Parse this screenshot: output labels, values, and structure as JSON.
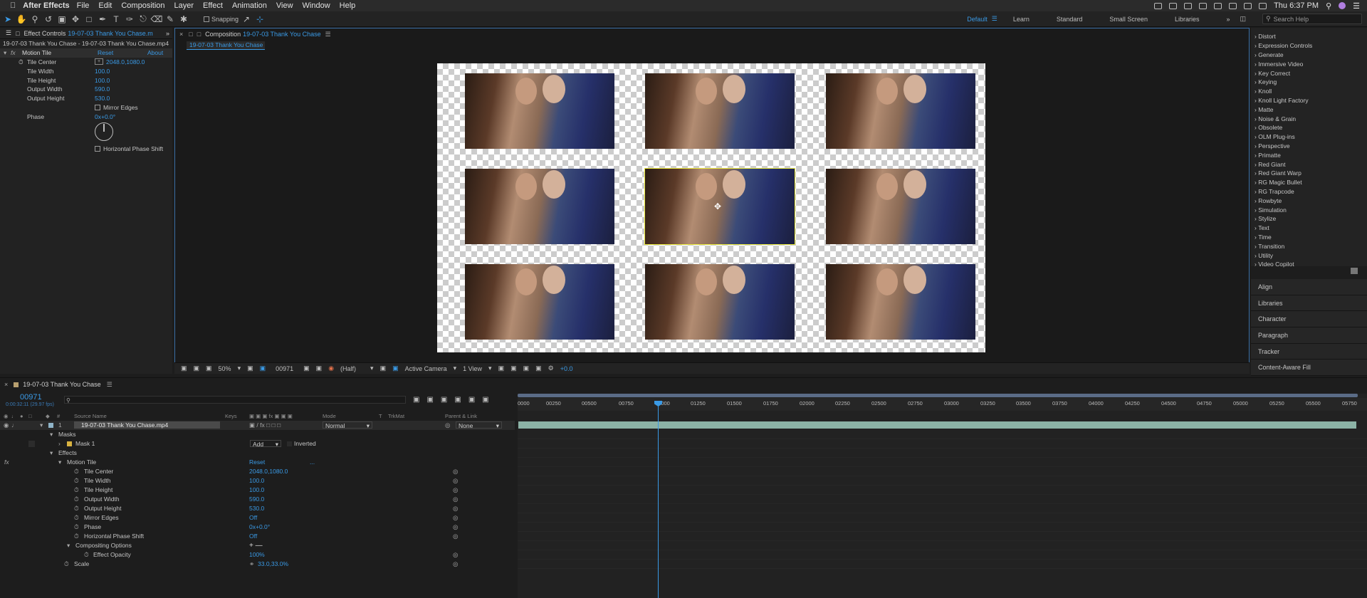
{
  "menubar": {
    "app_name": "After Effects",
    "items": [
      "File",
      "Edit",
      "Composition",
      "Layer",
      "Effect",
      "Animation",
      "View",
      "Window",
      "Help"
    ],
    "clock": "Thu 6:37 PM"
  },
  "toolbar": {
    "snapping_label": "Snapping",
    "workspaces": [
      "Default",
      "Learn",
      "Standard",
      "Small Screen",
      "Libraries"
    ],
    "active_workspace": "Default",
    "search_placeholder": "Search Help"
  },
  "effect_controls": {
    "tab_title": "Effect Controls",
    "tab_file": "19-07-03 Thank You Chase.m",
    "breadcrumb": "19-07-03 Thank You Chase - 19-07-03 Thank You Chase.mp4",
    "effect_name": "Motion Tile",
    "reset_label": "Reset",
    "about_label": "About",
    "params": [
      {
        "name": "Tile Center",
        "value": "2048.0,1080.0"
      },
      {
        "name": "Tile Width",
        "value": "100.0"
      },
      {
        "name": "Tile Height",
        "value": "100.0"
      },
      {
        "name": "Output Width",
        "value": "590.0"
      },
      {
        "name": "Output Height",
        "value": "530.0"
      }
    ],
    "mirror_edges_label": "Mirror Edges",
    "phase_label": "Phase",
    "phase_value": "0x+0.0°",
    "horizontal_phase_shift_label": "Horizontal Phase Shift"
  },
  "composition": {
    "tab_prefix": "Composition",
    "tab_name": "19-07-03 Thank You Chase",
    "sub_tab": "19-07-03 Thank You Chase",
    "footer": {
      "zoom": "50%",
      "timecode": "00971",
      "resolution": "(Half)",
      "camera": "Active Camera",
      "views": "1 View",
      "exposure": "+0.0"
    }
  },
  "effects_list": [
    "Distort",
    "Expression Controls",
    "Generate",
    "Immersive Video",
    "Key Correct",
    "Keying",
    "Knoll",
    "Knoll Light Factory",
    "Matte",
    "Noise & Grain",
    "Obsolete",
    "OLM Plug-ins",
    "Perspective",
    "Primatte",
    "Red Giant",
    "Red Giant Warp",
    "RG Magic Bullet",
    "RG Trapcode",
    "Rowbyte",
    "Simulation",
    "Stylize",
    "Text",
    "Time",
    "Transition",
    "Utility",
    "Video Copilot"
  ],
  "side_panels": [
    "Align",
    "Libraries",
    "Character",
    "Paragraph",
    "Tracker",
    "Content-Aware Fill"
  ],
  "timeline": {
    "tab_name": "19-07-03 Thank You Chase",
    "current_time": "00971",
    "time_sub": "0:00:32:11 (29.97 fps)",
    "columns": {
      "source": "Source Name",
      "keys": "Keys",
      "mode": "Mode",
      "t": "T",
      "trkmat": "TrkMat",
      "parent": "Parent & Link"
    },
    "layer": {
      "index": "1",
      "name": "19-07-03 Thank You Chase.mp4",
      "mode": "Normal",
      "parent": "None"
    },
    "masks_label": "Masks",
    "mask": {
      "name": "Mask 1",
      "mode": "Add",
      "inverted": "Inverted"
    },
    "effects_label": "Effects",
    "motion_tile_label": "Motion Tile",
    "reset_label": "Reset",
    "reset_dots": "...",
    "props": [
      {
        "name": "Tile Center",
        "value": "2048.0,1080.0"
      },
      {
        "name": "Tile Width",
        "value": "100.0"
      },
      {
        "name": "Tile Height",
        "value": "100.0"
      },
      {
        "name": "Output Width",
        "value": "590.0"
      },
      {
        "name": "Output Height",
        "value": "530.0"
      },
      {
        "name": "Mirror Edges",
        "value": "Off"
      },
      {
        "name": "Phase",
        "value": "0x+0.0°"
      },
      {
        "name": "Horizontal Phase Shift",
        "value": "Off"
      }
    ],
    "compositing_label": "Compositing Options",
    "compositing_ops": "+ —",
    "effect_opacity_label": "Effect Opacity",
    "effect_opacity_value": "100%",
    "scale_label": "Scale",
    "scale_value": "33.0,33.0%",
    "ruler": [
      "0000",
      "00250",
      "00500",
      "00750",
      "01000",
      "01250",
      "01500",
      "01750",
      "02000",
      "02250",
      "02500",
      "02750",
      "03000",
      "03250",
      "03500",
      "03750",
      "04000",
      "04250",
      "04500",
      "04750",
      "05000",
      "05250",
      "05500",
      "05750"
    ]
  },
  "colors": {
    "accent": "#3a9ae6",
    "selection": "#e8e83a",
    "clip": "#8cb3a6",
    "label": "#d9b340"
  }
}
